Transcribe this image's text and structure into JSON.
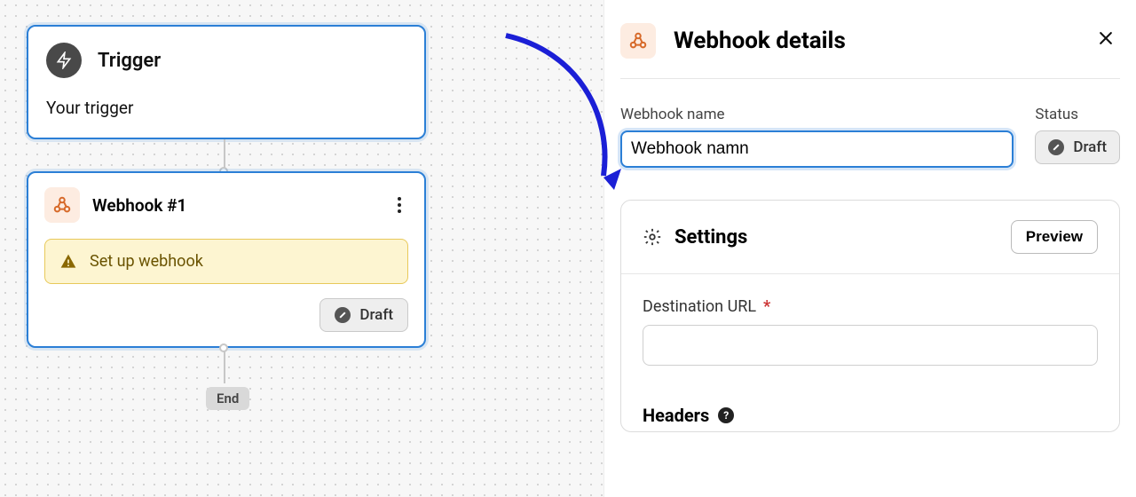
{
  "canvas": {
    "trigger": {
      "title": "Trigger",
      "subtitle": "Your trigger"
    },
    "webhook_card": {
      "title": "Webhook #1",
      "setup_banner": "Set up webhook",
      "status": "Draft"
    },
    "end_label": "End"
  },
  "panel": {
    "title": "Webhook details",
    "form": {
      "name_label": "Webhook name",
      "name_value": "Webhook namn",
      "status_label": "Status",
      "status_value": "Draft"
    },
    "settings": {
      "title": "Settings",
      "preview_label": "Preview",
      "destination_label": "Destination URL",
      "destination_value": "",
      "headers_label": "Headers"
    }
  }
}
